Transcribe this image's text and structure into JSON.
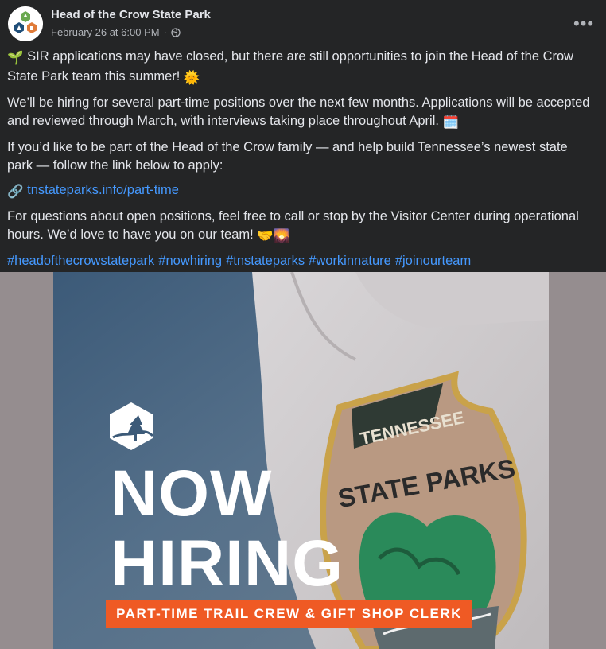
{
  "header": {
    "page_name": "Head of the Crow State Park",
    "timestamp": "February 26 at 6:00 PM",
    "separator": "·",
    "privacy_icon": "globe-icon",
    "more_icon": "more-dots-icon",
    "more_label": "•••"
  },
  "post": {
    "p1_emoji": "🌱",
    "p1_text": "SIR applications may have closed, but there are still opportunities to join the Head of the Crow State Park team this summer!",
    "p1_end_emoji": "🌞",
    "p2_text": "We’ll be hiring for several part-time positions over the next few months. Applications will be accepted and reviewed through March, with interviews taking place throughout April.",
    "p2_end_emoji": "🗓️",
    "p3_text": "If you’d like to be part of the Head of the Crow family — and help build Tennessee’s newest state park — follow the link below to apply:",
    "link_emoji": "🔗",
    "link_text": "tnstateparks.info/part-time",
    "p4_text": "For questions about open positions, feel free to call or stop by the Visitor Center during operational hours. We’d love to have you on our team!",
    "p4_end_emoji": "🤝🌄",
    "hashtags": [
      "#headofthecrowstatepark",
      "#nowhiring",
      "#tnstateparks",
      "#workinnature",
      "#joinourteam"
    ]
  },
  "image": {
    "headline_line1": "NOW",
    "headline_line2": "HIRING",
    "banner": "PART-TIME TRAIL CREW & GIFT SHOP CLERK",
    "patch_top": "TENNESSEE",
    "patch_main": "STATE PARKS",
    "colors": {
      "banner": "#ef5a24",
      "link": "#4599ff",
      "patch_border": "#c9a24a",
      "patch_fill": "#b99982"
    }
  }
}
